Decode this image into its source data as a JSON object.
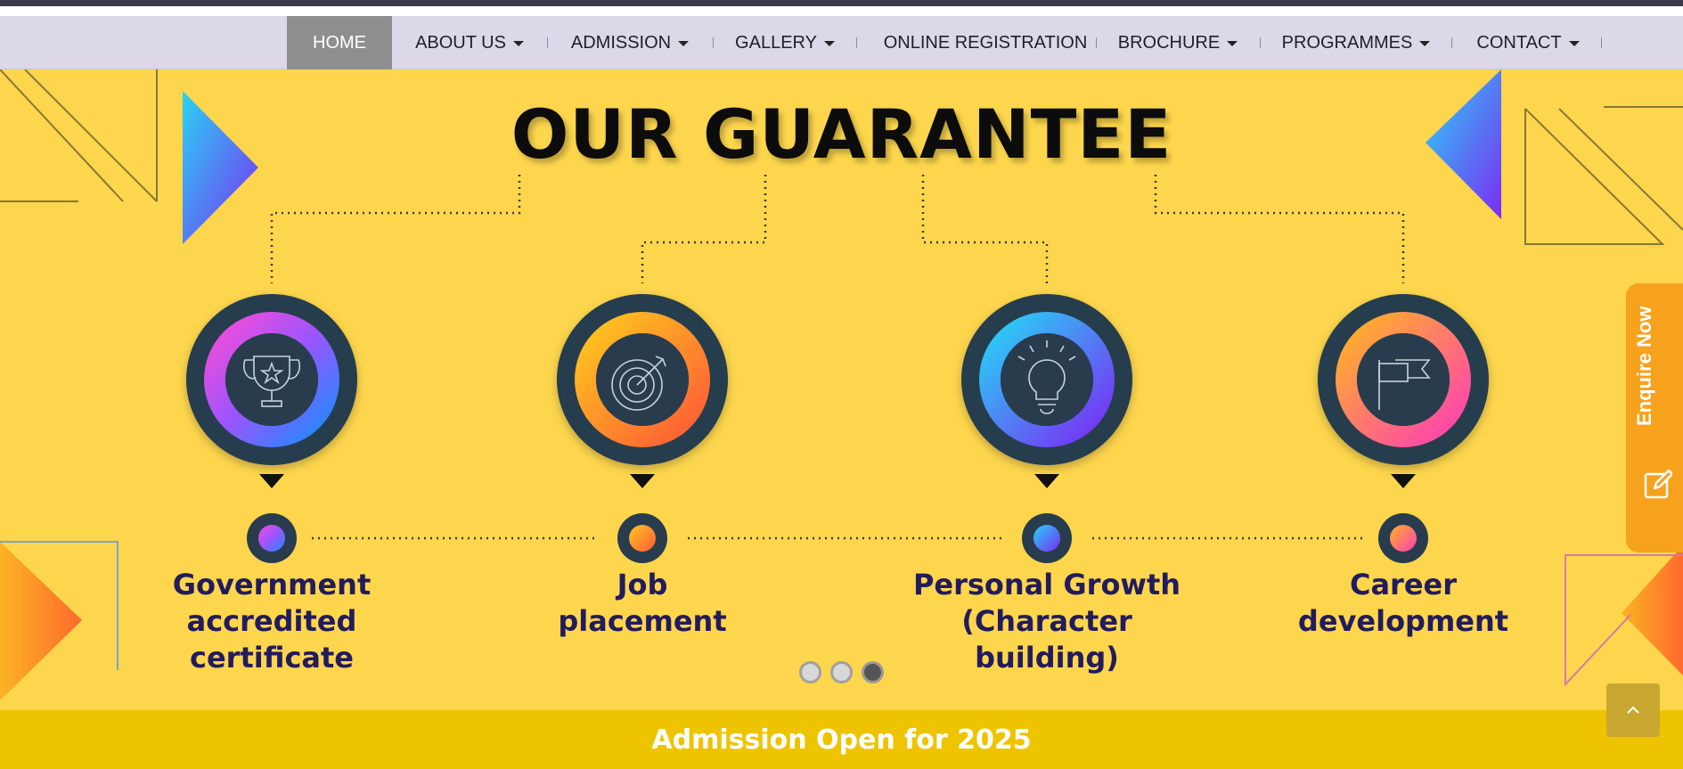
{
  "nav": {
    "items": [
      {
        "label": "HOME",
        "active": true,
        "has_dropdown": false
      },
      {
        "label": "ABOUT US",
        "active": false,
        "has_dropdown": true
      },
      {
        "label": "ADMISSION",
        "active": false,
        "has_dropdown": true
      },
      {
        "label": "GALLERY",
        "active": false,
        "has_dropdown": true
      },
      {
        "label": "ONLINE REGISTRATION",
        "active": false,
        "has_dropdown": false
      },
      {
        "label": "BROCHURE",
        "active": false,
        "has_dropdown": true
      },
      {
        "label": "PROGRAMMES",
        "active": false,
        "has_dropdown": true
      },
      {
        "label": "CONTACT",
        "active": false,
        "has_dropdown": true
      }
    ]
  },
  "hero": {
    "title": "OUR GUARANTEE",
    "background": "#fdd64d",
    "features": [
      {
        "icon": "trophy-icon",
        "lines": [
          "Government",
          "accredited",
          "certificate"
        ]
      },
      {
        "icon": "target-icon",
        "lines": [
          "Job",
          "placement"
        ]
      },
      {
        "icon": "lightbulb-icon",
        "lines": [
          "Personal Growth",
          "(Character",
          "building)"
        ]
      },
      {
        "icon": "flag-icon",
        "lines": [
          "Career",
          "development"
        ]
      }
    ],
    "slider": {
      "total": 3,
      "active": 3
    }
  },
  "enquire": {
    "label": "Enquire Now",
    "icon": "edit-icon"
  },
  "banner": {
    "text": "Admission Open for 2025",
    "color": "#eec400"
  },
  "back_to_top": {
    "icon": "chevron-up-icon"
  }
}
